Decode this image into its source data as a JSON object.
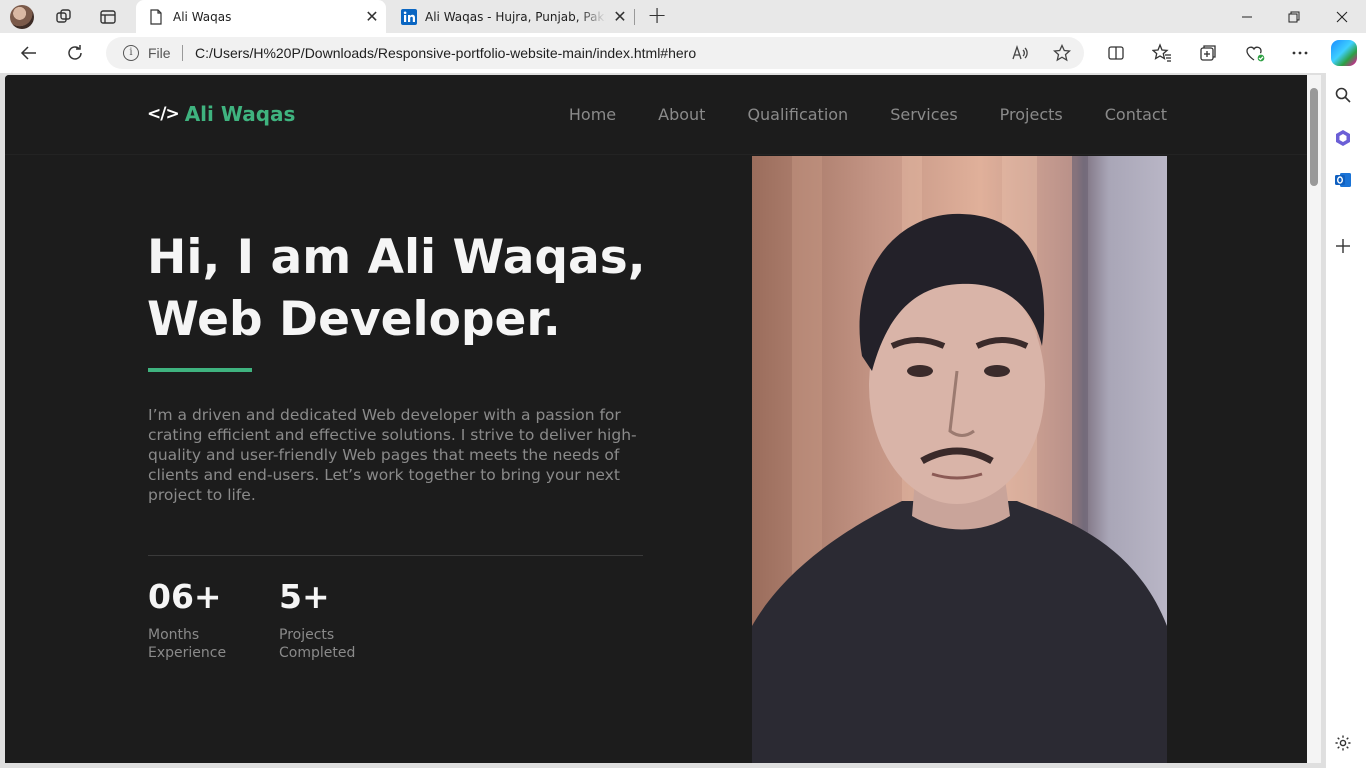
{
  "browser": {
    "tabs": [
      {
        "title": "Ali Waqas",
        "active": true
      },
      {
        "title": "Ali Waqas - Hujra, Punjab, Pakistan",
        "active": false
      }
    ],
    "address": {
      "scheme_label": "File",
      "url": "C:/Users/H%20P/Downloads/Responsive-portfolio-website-main/index.html#hero"
    }
  },
  "site": {
    "logo": {
      "code_symbol": "</>",
      "name": "Ali Waqas"
    },
    "nav": [
      "Home",
      "About",
      "Qualification",
      "Services",
      "Projects",
      "Contact"
    ],
    "hero": {
      "title_line1": "Hi, I am Ali Waqas,",
      "title_line2": "Web Developer.",
      "description": "I’m a driven and dedicated Web developer with a passion for crating efficient and effective solutions. I strive to deliver high-quality and user-friendly Web pages that meets the needs of clients and end-users. Let’s work together to bring your next project to life.",
      "stats": [
        {
          "value": "06+",
          "label_line1": "Months",
          "label_line2": "Experience"
        },
        {
          "value": "5+",
          "label_line1": "Projects",
          "label_line2": "Completed"
        }
      ]
    }
  },
  "colors": {
    "accent": "#3fb37f",
    "page_background": "#1c1c1c",
    "muted_text": "#8a8a8a"
  }
}
